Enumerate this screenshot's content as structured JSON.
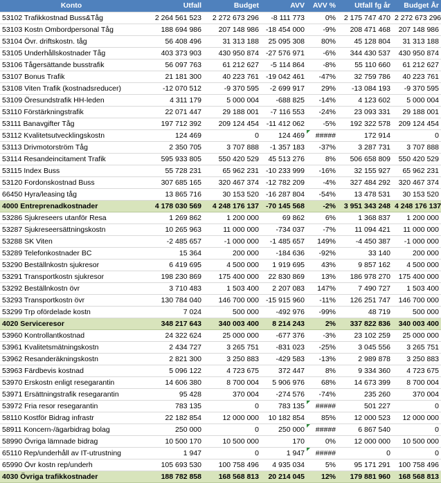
{
  "headers": [
    "Konto",
    "Utfall",
    "Budget",
    "AVV",
    "AVV %",
    "Utfall fg år",
    "Budget År"
  ],
  "rows": [
    {
      "cells": [
        "53102 Trafikkostnad Buss&Tåg",
        "2 264 561 523",
        "2 272 673 296",
        "-8 111 773",
        "0%",
        "2 175 747 470",
        "2 272 673 296"
      ]
    },
    {
      "cells": [
        "53103 Kostn Ombordpersonal Tåg",
        "188 694 986",
        "207 148 986",
        "-18 454 000",
        "-9%",
        "208 471 468",
        "207 148 986"
      ]
    },
    {
      "cells": [
        "53104 Övr. driftskostn. tåg",
        "56 408 496",
        "31 313 188",
        "25 095 308",
        "80%",
        "45 128 804",
        "31 313 188"
      ]
    },
    {
      "cells": [
        "53105 Underhållskostnader Tåg",
        "403 373 903",
        "430 950 874",
        "-27 576 971",
        "-6%",
        "344 430 537",
        "430 950 874"
      ]
    },
    {
      "cells": [
        "53106 Tågersättande busstrafik",
        "56 097 763",
        "61 212 627",
        "-5 114 864",
        "-8%",
        "55 110 660",
        "61 212 627"
      ]
    },
    {
      "cells": [
        "53107 Bonus Trafik",
        "21 181 300",
        "40 223 761",
        "-19 042 461",
        "-47%",
        "32 759 786",
        "40 223 761"
      ]
    },
    {
      "cells": [
        "53108 Viten Trafik (kostnadsreducer)",
        "-12 070 512",
        "-9 370 595",
        "-2 699 917",
        "29%",
        "-13 084 193",
        "-9 370 595"
      ]
    },
    {
      "cells": [
        "53109 Öresundstrafik HH-leden",
        "4 311 179",
        "5 000 004",
        "-688 825",
        "-14%",
        "4 123 602",
        "5 000 004"
      ]
    },
    {
      "cells": [
        "53110 Förstärkningstrafik",
        "22 071 447",
        "29 188 001",
        "-7 116 553",
        "-24%",
        "23 093 331",
        "29 188 001"
      ]
    },
    {
      "cells": [
        "53111 Banavgifter Tåg",
        "197 712 392",
        "209 124 454",
        "-11 412 062",
        "-5%",
        "192 322 578",
        "209 124 454"
      ]
    },
    {
      "cells": [
        "53112 Kvalitetsutvecklingskostn",
        "124 469",
        "0",
        "124 469",
        "#####",
        "172 914",
        "0"
      ],
      "err": true
    },
    {
      "cells": [
        "53113 Drivmotorström Tåg",
        "2 350 705",
        "3 707 888",
        "-1 357 183",
        "-37%",
        "3 287 731",
        "3 707 888"
      ]
    },
    {
      "cells": [
        "53114 Resandeincitament Trafik",
        "595 933 805",
        "550 420 529",
        "45 513 276",
        "8%",
        "506 658 809",
        "550 420 529"
      ]
    },
    {
      "cells": [
        "53115 Index Buss",
        "55 728 231",
        "65 962 231",
        "-10 233 999",
        "-16%",
        "32 155 927",
        "65 962 231"
      ]
    },
    {
      "cells": [
        "53120 Fordonskostnad Buss",
        "307 685 165",
        "320 467 374",
        "-12 782 209",
        "-4%",
        "327 484 292",
        "320 467 374"
      ]
    },
    {
      "cells": [
        "66450 Hyra/leasing tåg",
        "13 865 716",
        "30 153 520",
        "-16 287 804",
        "-54%",
        "13 478 531",
        "30 153 520"
      ]
    },
    {
      "cells": [
        "4000 Entreprenadkostnader",
        "4 178 030 569",
        "4 248 176 137",
        "-70 145 568",
        "-2%",
        "3 951 343 248",
        "4 248 176 137"
      ],
      "total": true
    },
    {
      "cells": [
        "53286 Sjukreseers utanför Resa",
        "1 269 862",
        "1 200 000",
        "69 862",
        "6%",
        "1 368 837",
        "1 200 000"
      ]
    },
    {
      "cells": [
        "53287 Sjukreseersättningskostn",
        "10 265 963",
        "11 000 000",
        "-734 037",
        "-7%",
        "11 094 421",
        "11 000 000"
      ]
    },
    {
      "cells": [
        "53288 SK Viten",
        "-2 485 657",
        "-1 000 000",
        "-1 485 657",
        "149%",
        "-4 450 387",
        "-1 000 000"
      ]
    },
    {
      "cells": [
        "53289 Telefonkostnader BC",
        "15 364",
        "200 000",
        "-184 636",
        "-92%",
        "33 140",
        "200 000"
      ]
    },
    {
      "cells": [
        "53290 Beställnkostn sjukresor",
        "6 419 695",
        "4 500 000",
        "1 919 695",
        "43%",
        "9 857 162",
        "4 500 000"
      ]
    },
    {
      "cells": [
        "53291 Transportkostn sjukresor",
        "198 230 869",
        "175 400 000",
        "22 830 869",
        "13%",
        "186 978 270",
        "175 400 000"
      ]
    },
    {
      "cells": [
        "53292 Beställnkostn övr",
        "3 710 483",
        "1 503 400",
        "2 207 083",
        "147%",
        "7 490 727",
        "1 503 400"
      ]
    },
    {
      "cells": [
        "53293 Transportkostn övr",
        "130 784 040",
        "146 700 000",
        "-15 915 960",
        "-11%",
        "126 251 747",
        "146 700 000"
      ]
    },
    {
      "cells": [
        "53299 Trp ofördelade kostn",
        "7 024",
        "500 000",
        "-492 976",
        "-99%",
        "48 719",
        "500 000"
      ]
    },
    {
      "cells": [
        "4020 Serviceresor",
        "348 217 643",
        "340 003 400",
        "8 214 243",
        "2%",
        "337 822 836",
        "340 003 400"
      ],
      "total": true
    },
    {
      "cells": [
        "53960 Kontrollantkostnad",
        "24 322 624",
        "25 000 000",
        "-677 376",
        "-3%",
        "23 102 259",
        "25 000 000"
      ]
    },
    {
      "cells": [
        "53961 Kvalitetsmätningskostn",
        "2 434 727",
        "3 265 751",
        "-831 023",
        "-25%",
        "3 045 556",
        "3 265 751"
      ]
    },
    {
      "cells": [
        "53962 Resanderäkningskostn",
        "2 821 300",
        "3 250 883",
        "-429 583",
        "-13%",
        "2 989 878",
        "3 250 883"
      ]
    },
    {
      "cells": [
        "53963 Färdbevis kostnad",
        "5 096 122",
        "4 723 675",
        "372 447",
        "8%",
        "9 334 360",
        "4 723 675"
      ]
    },
    {
      "cells": [
        "53970 Erskostn enligt resegarantin",
        "14 606 380",
        "8 700 004",
        "5 906 976",
        "68%",
        "14 673 399",
        "8 700 004"
      ]
    },
    {
      "cells": [
        "53971 Ersättningstrafik resegarantin",
        "95 428",
        "370 004",
        "-274 576",
        "-74%",
        "235 260",
        "370 004"
      ]
    },
    {
      "cells": [
        "53972 Fria resor resegarantin",
        "783 135",
        "0",
        "783 135",
        "#####",
        "501 227",
        "0"
      ],
      "err": true
    },
    {
      "cells": [
        "58110 Kostför Bidrag infrastr",
        "22 182 854",
        "12 000 000",
        "10 182 854",
        "85%",
        "12 000 523",
        "12 000 000"
      ]
    },
    {
      "cells": [
        "58911 Koncern-/ägarbidrag bolag",
        "250 000",
        "0",
        "250 000",
        "#####",
        "6 867 540",
        "0"
      ],
      "err": true
    },
    {
      "cells": [
        "58990 Övriga lämnade bidrag",
        "10 500 170",
        "10 500 000",
        "170",
        "0%",
        "12 000 000",
        "10 500 000"
      ]
    },
    {
      "cells": [
        "65110 Rep/underhåll av IT-utrustning",
        "1 947",
        "0",
        "1 947",
        "#####",
        "0",
        "0"
      ],
      "err": true
    },
    {
      "cells": [
        "65990 Övr kostn rep/underh",
        "105 693 530",
        "100 758 496",
        "4 935 034",
        "5%",
        "95 171 291",
        "100 758 496"
      ]
    },
    {
      "cells": [
        "4030 Övriga trafikkostnader",
        "188 782 858",
        "168 568 813",
        "20 214 045",
        "12%",
        "179 881 960",
        "168 568 813"
      ],
      "total": true
    }
  ]
}
